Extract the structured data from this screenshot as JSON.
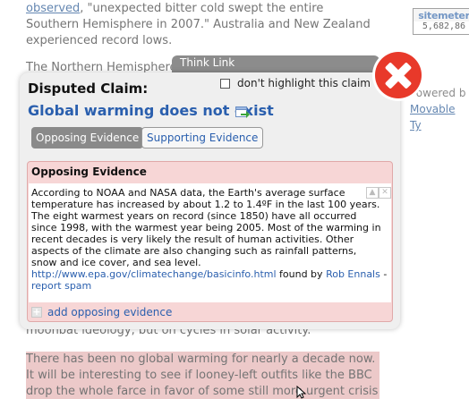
{
  "background": {
    "para1": {
      "link": "observed",
      "rest": ", \"unexpected bitter cold swept the entire Southern Hemisphere in 2007.\" Australia and New Zealand experienced record lows."
    },
    "para2": "The Northern Hemisphere",
    "para3": "moonbat ideology, but on cycles in solar activity.",
    "para4": "There has been no global warming for nearly a decade now. It will be interesting to see if looney-left outfits like the BBC drop the whole farce in favor of some still more urgent crisis in time",
    "sitemeter": {
      "label": "sitemeter",
      "count": "5,682,86"
    },
    "powered": {
      "text": "Powered b",
      "link": "Movable Ty"
    }
  },
  "popup": {
    "title": "Think Link",
    "claim_label": "Disputed Claim:",
    "dont_highlight": "don't highlight this claim",
    "claim": "Global warming does not exist",
    "tabs": {
      "opposing": "Opposing Evidence",
      "supporting": "Supporting Evidence"
    },
    "evidence_header": "Opposing Evidence",
    "evidence_text": "According to NOAA and NASA data, the Earth's average surface temperature has increased by about 1.2 to 1.4ºF in the last 100 years. The eight warmest years on record (since 1850) have all occurred since 1998, with the warmest year being 2005. Most of the warming in recent decades is very likely the result of human activities. Other aspects of the climate are also changing such as rainfall patterns, snow and ice cover, and sea level.",
    "evidence_url": "http://www.epa.gov/climatechange/basicinfo.html",
    "found_by_label": "found by",
    "found_by_user": "Rob Ennals",
    "dash": "-",
    "report_spam": "report spam",
    "add_evidence": "add opposing evidence"
  },
  "colors": {
    "accent_blue": "#2a5fae",
    "close_red": "#e8392a",
    "evidence_pink": "#f7d6d6",
    "highlight_pink": "#e4b0b0"
  },
  "icons": [
    "close-icon",
    "external-link-icon",
    "vote-up-icon",
    "vote-x-icon",
    "plus-icon",
    "mouse-cursor-icon"
  ]
}
